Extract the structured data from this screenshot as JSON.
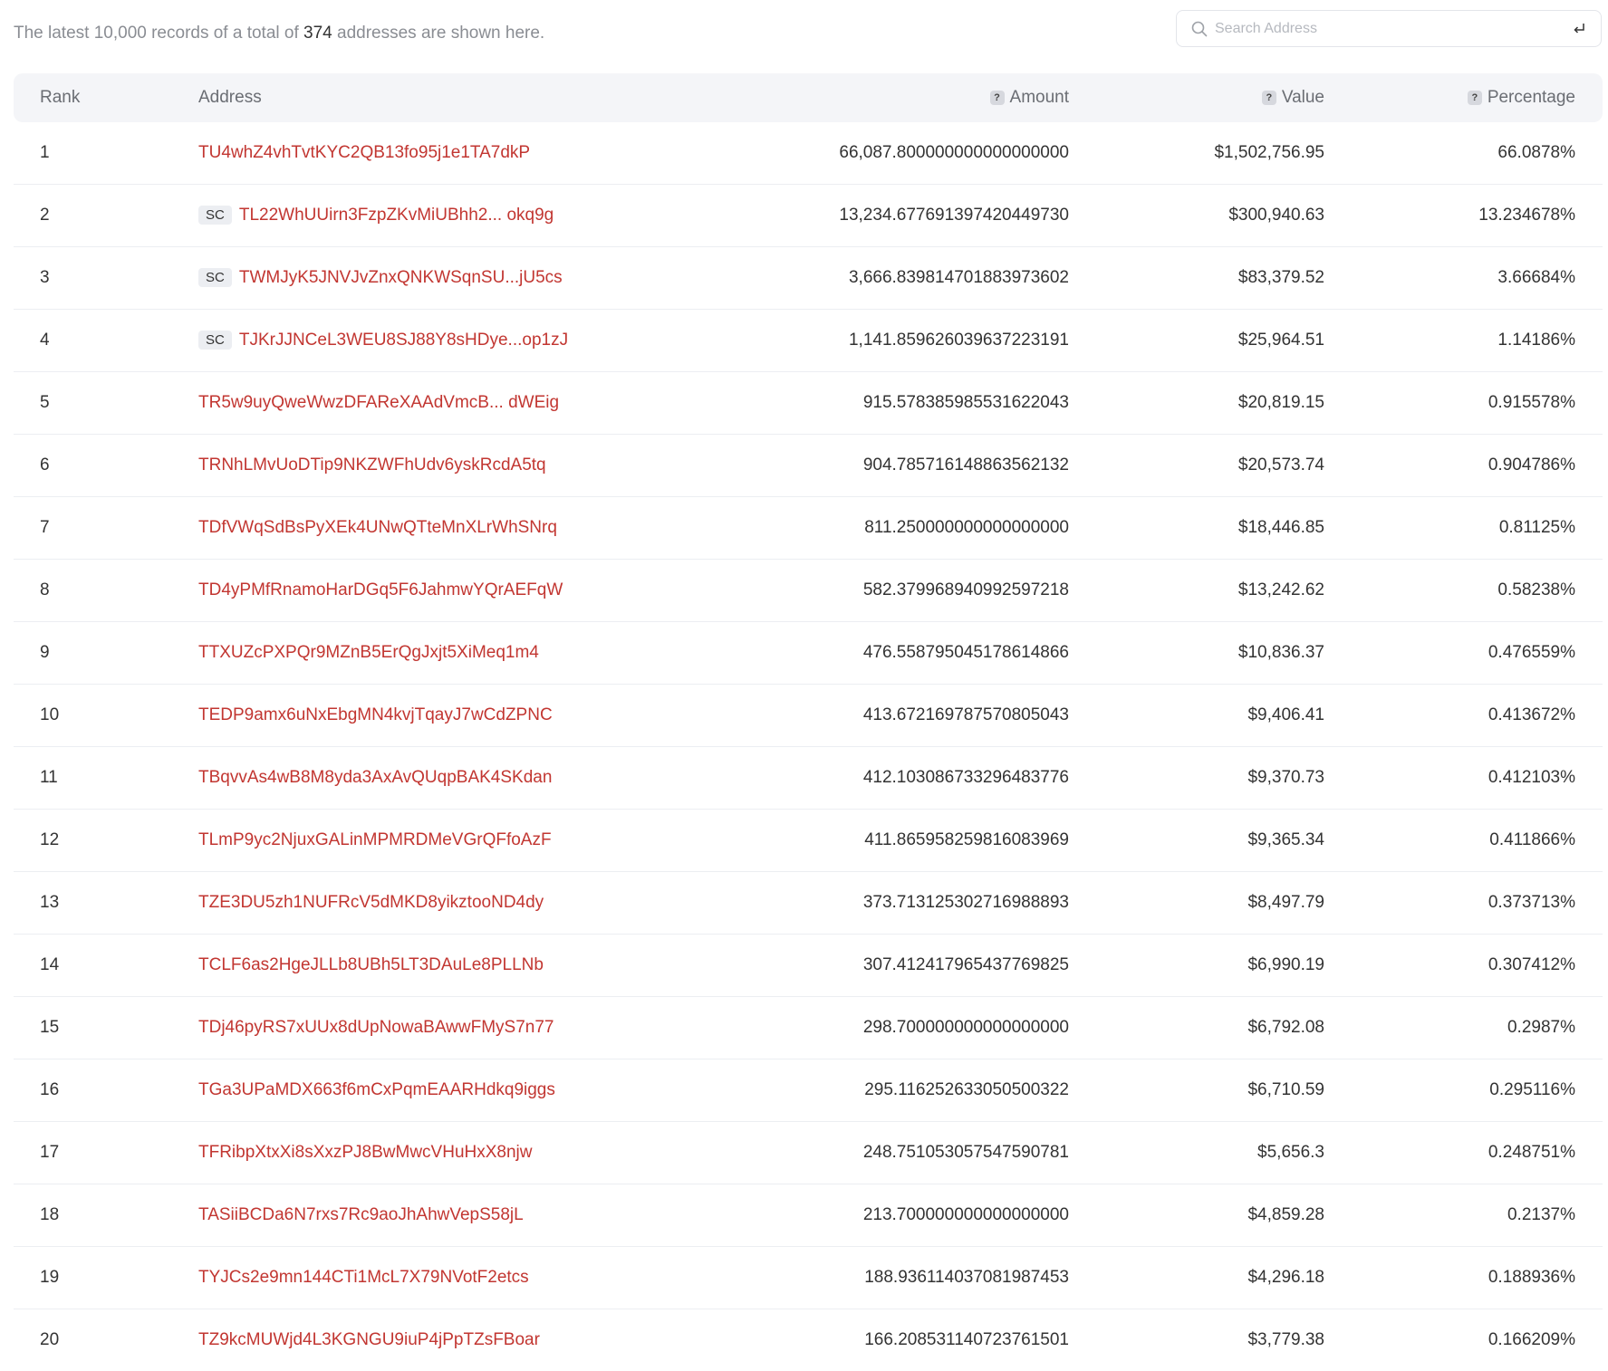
{
  "summary": {
    "prefix": "The latest 10,000 records of a total of",
    "count": "374",
    "suffix": "addresses are shown here."
  },
  "search": {
    "placeholder": "Search Address",
    "value": ""
  },
  "table": {
    "headers": {
      "rank": "Rank",
      "address": "Address",
      "amount": "Amount",
      "value": "Value",
      "percentage": "Percentage"
    },
    "sc_label": "SC",
    "rows": [
      {
        "rank": "1",
        "sc": false,
        "address": "TU4whZ4vhTvtKYC2QB13fo95j1e1TA7dkP",
        "amount": "66,087.800000000000000000",
        "value": "$1,502,756.95",
        "percentage": "66.0878%"
      },
      {
        "rank": "2",
        "sc": true,
        "address": "TL22WhUUirn3FzpZKvMiUBhh2... okq9g",
        "amount": "13,234.677691397420449730",
        "value": "$300,940.63",
        "percentage": "13.234678%"
      },
      {
        "rank": "3",
        "sc": true,
        "address": "TWMJyK5JNVJvZnxQNKWSqnSU...jU5cs",
        "amount": "3,666.839814701883973602",
        "value": "$83,379.52",
        "percentage": "3.66684%"
      },
      {
        "rank": "4",
        "sc": true,
        "address": "TJKrJJNCeL3WEU8SJ88Y8sHDye...op1zJ",
        "amount": "1,141.859626039637223191",
        "value": "$25,964.51",
        "percentage": "1.14186%"
      },
      {
        "rank": "5",
        "sc": false,
        "address": "TR5w9uyQweWwzDFAReXAAdVmcB... dWEig",
        "amount": "915.578385985531622043",
        "value": "$20,819.15",
        "percentage": "0.915578%"
      },
      {
        "rank": "6",
        "sc": false,
        "address": "TRNhLMvUoDTip9NKZWFhUdv6yskRcdA5tq",
        "amount": "904.785716148863562132",
        "value": "$20,573.74",
        "percentage": "0.904786%"
      },
      {
        "rank": "7",
        "sc": false,
        "address": "TDfVWqSdBsPyXEk4UNwQTteMnXLrWhSNrq",
        "amount": "811.250000000000000000",
        "value": "$18,446.85",
        "percentage": "0.81125%"
      },
      {
        "rank": "8",
        "sc": false,
        "address": "TD4yPMfRnamoHarDGq5F6JahmwYQrAEFqW",
        "amount": "582.379968940992597218",
        "value": "$13,242.62",
        "percentage": "0.58238%"
      },
      {
        "rank": "9",
        "sc": false,
        "address": "TTXUZcPXPQr9MZnB5ErQgJxjt5XiMeq1m4",
        "amount": "476.558795045178614866",
        "value": "$10,836.37",
        "percentage": "0.476559%"
      },
      {
        "rank": "10",
        "sc": false,
        "address": "TEDP9amx6uNxEbgMN4kvjTqayJ7wCdZPNC",
        "amount": "413.672169787570805043",
        "value": "$9,406.41",
        "percentage": "0.413672%"
      },
      {
        "rank": "11",
        "sc": false,
        "address": "TBqvvAs4wB8M8yda3AxAvQUqpBAK4SKdan",
        "amount": "412.103086733296483776",
        "value": "$9,370.73",
        "percentage": "0.412103%"
      },
      {
        "rank": "12",
        "sc": false,
        "address": "TLmP9yc2NjuxGALinMPMRDMeVGrQFfoAzF",
        "amount": "411.865958259816083969",
        "value": "$9,365.34",
        "percentage": "0.411866%"
      },
      {
        "rank": "13",
        "sc": false,
        "address": "TZE3DU5zh1NUFRcV5dMKD8yikztooND4dy",
        "amount": "373.713125302716988893",
        "value": "$8,497.79",
        "percentage": "0.373713%"
      },
      {
        "rank": "14",
        "sc": false,
        "address": "TCLF6as2HgeJLLb8UBh5LT3DAuLe8PLLNb",
        "amount": "307.412417965437769825",
        "value": "$6,990.19",
        "percentage": "0.307412%"
      },
      {
        "rank": "15",
        "sc": false,
        "address": "TDj46pyRS7xUUx8dUpNowaBAwwFMyS7n77",
        "amount": "298.700000000000000000",
        "value": "$6,792.08",
        "percentage": "0.2987%"
      },
      {
        "rank": "16",
        "sc": false,
        "address": "TGa3UPaMDX663f6mCxPqmEAARHdkq9iggs",
        "amount": "295.116252633050500322",
        "value": "$6,710.59",
        "percentage": "0.295116%"
      },
      {
        "rank": "17",
        "sc": false,
        "address": "TFRibpXtxXi8sXxzPJ8BwMwcVHuHxX8njw",
        "amount": "248.751053057547590781",
        "value": "$5,656.3",
        "percentage": "0.248751%"
      },
      {
        "rank": "18",
        "sc": false,
        "address": "TASiiBCDa6N7rxs7Rc9aoJhAhwVepS58jL",
        "amount": "213.700000000000000000",
        "value": "$4,859.28",
        "percentage": "0.2137%"
      },
      {
        "rank": "19",
        "sc": false,
        "address": "TYJCs2e9mn144CTi1McL7X79NVotF2etcs",
        "amount": "188.936114037081987453",
        "value": "$4,296.18",
        "percentage": "0.188936%"
      },
      {
        "rank": "20",
        "sc": false,
        "address": "TZ9kcMUWjd4L3KGNGU9iuP4jPpTZsFBoar",
        "amount": "166.208531140723761501",
        "value": "$3,779.38",
        "percentage": "0.166209%"
      }
    ]
  }
}
